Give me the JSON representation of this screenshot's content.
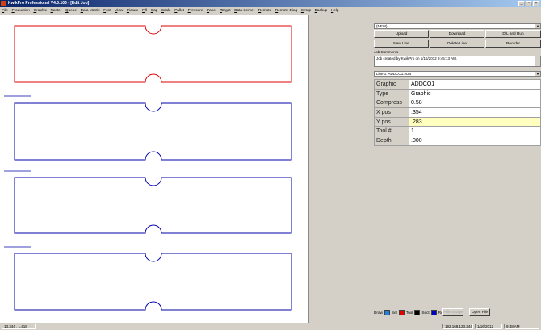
{
  "window": {
    "title": "KwikPro Professional V4.0.106 - [Edit Job]",
    "min": "_",
    "restore": "▫",
    "close": "×"
  },
  "menu": [
    "File",
    "Production",
    "Graphic",
    "Raster",
    "Queue",
    "Data Matrix",
    "Font",
    "View",
    "Picture",
    "Fill",
    "Cap",
    "Scale",
    "Pallet",
    "Pressure",
    "Panel",
    "Target",
    "Data Server",
    "Remote",
    "Remote Diag",
    "Setup",
    "Backup",
    "Help"
  ],
  "right_panel": {
    "top_dropdown": "(NEW)",
    "buttons_row1": [
      "Upload",
      "Download",
      "D/L and Run"
    ],
    "buttons_row2": [
      "New Line",
      "Delete Line",
      "Reorder"
    ],
    "comments_label": "Job Comments",
    "comments_text": "Job created by KwikPro on 1/16/2012 9:45:13 AM.",
    "line_dropdown": "Line 1: ADDCO1.JOB",
    "properties": [
      {
        "key": "Graphic",
        "value": "ADDCO1"
      },
      {
        "key": "Type",
        "value": "Graphic"
      },
      {
        "key": "Compress",
        "value": "0.58"
      },
      {
        "key": "X pos",
        "value": ".354"
      },
      {
        "key": "Y pos",
        "value": ".283"
      },
      {
        "key": "Tool #",
        "value": "1"
      },
      {
        "key": "Depth",
        "value": ".000"
      }
    ],
    "legend": {
      "draw": "Draw",
      "sel": "Sel",
      "tool": "Tool",
      "sect": "Sect",
      "ret": "Ret",
      "print_image": "Print Image",
      "open_file": "Open File"
    }
  },
  "status": {
    "coords": "13.344 , 1.418",
    "ip": "192.168.123.244",
    "date": "1/16/2012",
    "time": "9:48 AM"
  },
  "colors": {
    "title_start": "#0a246a",
    "selected": "#dd0000",
    "normal": "#0000aa",
    "highlight_row": "#ffffc0",
    "draw_swatch": "#2080e0",
    "sel_swatch": "#e00000",
    "tool_swatch": "#000000",
    "sect_swatch": "#0000c0",
    "ret_swatch": "#ff9020"
  },
  "icons": [
    "app-icon",
    "minimize-icon",
    "restore-icon",
    "close-icon",
    "dropdown-arrow-icon"
  ]
}
